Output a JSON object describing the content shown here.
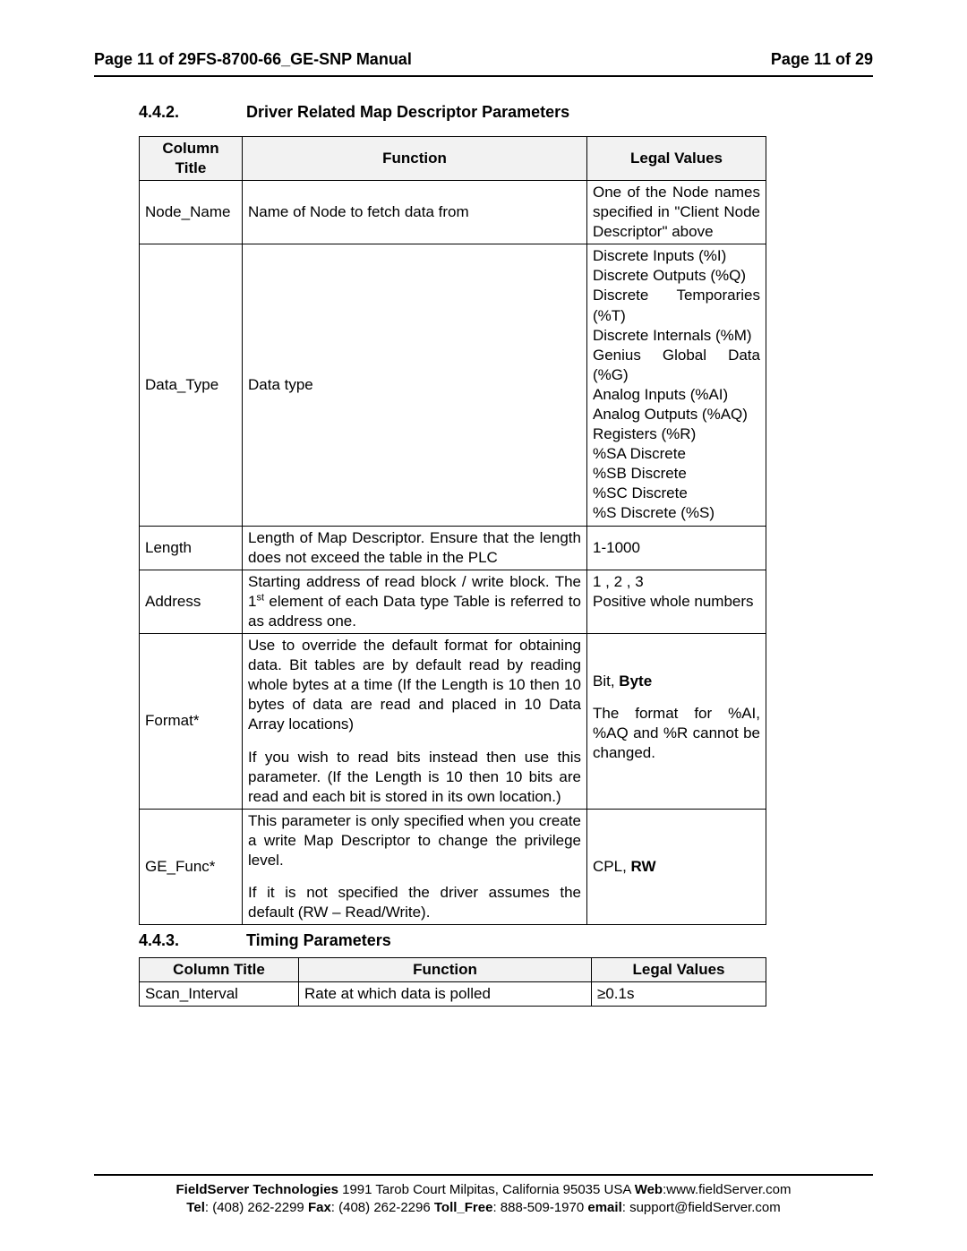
{
  "header": {
    "left": "Page 11 of 29FS-8700-66_GE-SNP Manual",
    "right": "Page 11 of 29"
  },
  "section442": {
    "num": "4.4.2.",
    "title": "Driver Related Map Descriptor Parameters",
    "thead": {
      "col1": "Column Title",
      "col2": "Function",
      "col3": "Legal Values"
    },
    "rows": {
      "r1": {
        "col1": "Node_Name",
        "col2": "Name of Node to fetch data from",
        "col3": "One of the Node names specified in \"Client Node Descriptor\" above"
      },
      "r2": {
        "col1": "Data_Type",
        "col2": "Data type",
        "col3_lines": {
          "l1": "Discrete Inputs (%I)",
          "l2": "Discrete Outputs (%Q)",
          "l3": "Discrete Temporaries (%T)",
          "l4": "Discrete Internals (%M)",
          "l5": "Genius Global Data (%G)",
          "l6": "Analog Inputs (%AI)",
          "l7": "Analog Outputs (%AQ)",
          "l8": "Registers (%R)",
          "l9": "%SA Discrete",
          "l10": "%SB Discrete",
          "l11": "%SC Discrete",
          "l12": "%S Discrete (%S)"
        }
      },
      "r3": {
        "col1": "Length",
        "col2": "Length of Map Descriptor.  Ensure that the length does not exceed the table in the PLC",
        "col3": "1-1000"
      },
      "r4": {
        "col1": "Address",
        "col2_pre": "Starting address of read block / write block.  The 1",
        "col2_sup": "st",
        "col2_post": " element of each Data type Table is referred to as address one.",
        "col3_l1": "1 , 2 , 3",
        "col3_l2": "Positive whole numbers"
      },
      "r5": {
        "col1": "Format*",
        "col2_p1": "Use to override the default format for obtaining data. Bit tables are by default read by reading whole bytes at a time (If the Length is 10 then 10 bytes of data are read and placed in 10 Data Array locations)",
        "col2_p2": "If you wish to read bits instead then use this parameter. (If the Length is 10 then 10 bits are read and each bit is stored in its own location.)",
        "col3_l1_pre": "Bit, ",
        "col3_l1_bold": "Byte",
        "col3_l2": "The format for %AI, %AQ and %R cannot be changed."
      },
      "r6": {
        "col1": "GE_Func*",
        "col2_p1": "This parameter is only specified when you create a write Map Descriptor to change the privilege level.",
        "col2_p2": "If it is not specified the driver assumes the default (RW – Read/Write).",
        "col3_pre": "CPL, ",
        "col3_bold": "RW"
      }
    }
  },
  "section443": {
    "num": "4.4.3.",
    "title": "Timing Parameters",
    "thead": {
      "col1": "Column Title",
      "col2": "Function",
      "col3": "Legal Values"
    },
    "rows": {
      "r1": {
        "col1": "Scan_Interval",
        "col2": "Rate at which data is polled",
        "col3": "≥0.1s"
      }
    }
  },
  "footer": {
    "company_bold": "FieldServer Technologies",
    "addr": " 1991 Tarob Court Milpitas, California 95035 USA  ",
    "web_label": "Web",
    "web_value": ":www.fieldServer.com",
    "tel_label": "Tel",
    "tel_value": ": (408) 262-2299   ",
    "fax_label": "Fax",
    "fax_value": ": (408) 262-2296   ",
    "tollfree_label": "Toll_Free",
    "tollfree_value": ": 888-509-1970   ",
    "email_label": "email",
    "email_value": ": support@fieldServer.com"
  }
}
